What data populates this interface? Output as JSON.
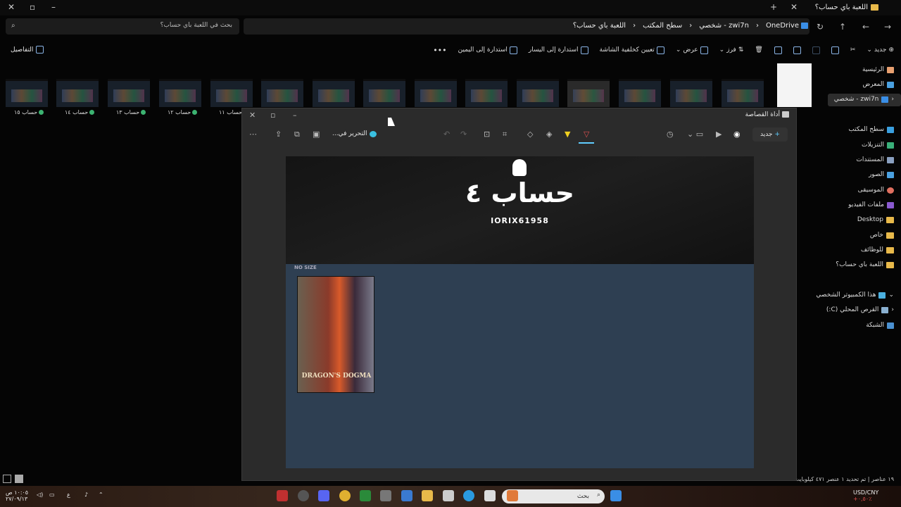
{
  "explorer": {
    "title": "اللعبة باي حساب؟",
    "search_placeholder": "بحث في اللعبة باي حساب؟",
    "breadcrumbs": [
      "OneDrive",
      "zwi7n - شخصي",
      "سطح المكتب",
      "اللعبة باي حساب؟"
    ],
    "toolbar": {
      "new": "جديد",
      "sort": "فرز",
      "view": "عرض",
      "wallpaper": "تعيين كخلفية الشاشة",
      "rotate_left": "استدارة إلى اليسار",
      "rotate_right": "استدارة إلى اليمين",
      "more": "•••",
      "details": "التفاصيل"
    },
    "thumb_labels": [
      "حساب ١٥",
      "حساب ١٤",
      "حساب ١٣",
      "حساب ١٢",
      "حساب ١١"
    ],
    "sidebar": {
      "home": "الرئيسية",
      "gallery": "المعرض",
      "onedrive": "zwi7n - شخصي",
      "desktop": "سطح المكتب",
      "downloads": "التنزيلات",
      "documents": "المستندات",
      "pictures": "الصور",
      "music": "الموسيقى",
      "videos": "ملفات الفيديو",
      "desktop_en": "Desktop",
      "private": "خاص",
      "jobs": "للوظائف",
      "game": "اللعبة باي حساب؟",
      "this_pc": "هذا الكمبيوتر الشخصي",
      "local_disk": "القرص المحلي (C:)",
      "network": "الشبكة"
    },
    "status": {
      "items": "١٩ عناصر",
      "selected": "تم تحديد ١ عنصر ٤٧١ كيلوبايت"
    }
  },
  "snipping": {
    "title": "أداة القصاصة",
    "new_label": "جديد",
    "edit_in": "التحرير في...",
    "image": {
      "title": "حساب ٤",
      "username": "IORIX61958",
      "section": "NO SIZE",
      "game": "DRAGON'S DOGMA"
    }
  },
  "taskbar": {
    "search": "بحث",
    "currency": "USD/CNY",
    "currency_change": "+٠,٥٠٪",
    "time": "١٠:٠٥ ص",
    "date": "٢٧/٠٩/١٣",
    "lang": "ع"
  },
  "colors": {
    "accent": "#60cdff",
    "folder": "#e8b94a"
  }
}
